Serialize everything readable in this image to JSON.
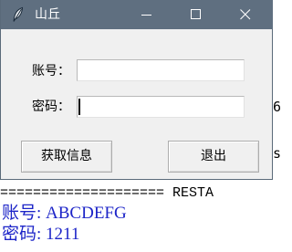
{
  "window": {
    "title": "山丘",
    "icon": "feather-icon",
    "controls": [
      "minimize-icon",
      "maximize-icon",
      "close-icon"
    ]
  },
  "form": {
    "account_label": "账号：",
    "account_value": "",
    "password_label": "密码：",
    "password_value": ""
  },
  "buttons": {
    "fetch_label": "获取信息",
    "exit_label": "退出"
  },
  "console": {
    "side_char_1": "6",
    "side_char_2": "s",
    "separator": "==================== RESTA",
    "output_line_1": "账号: ABCDEFG",
    "output_line_2": "密码: 1211"
  },
  "colors": {
    "titlebar": "#5f6f80",
    "dialog_bg": "#f0f0f0",
    "console_output": "#1d25c8"
  }
}
